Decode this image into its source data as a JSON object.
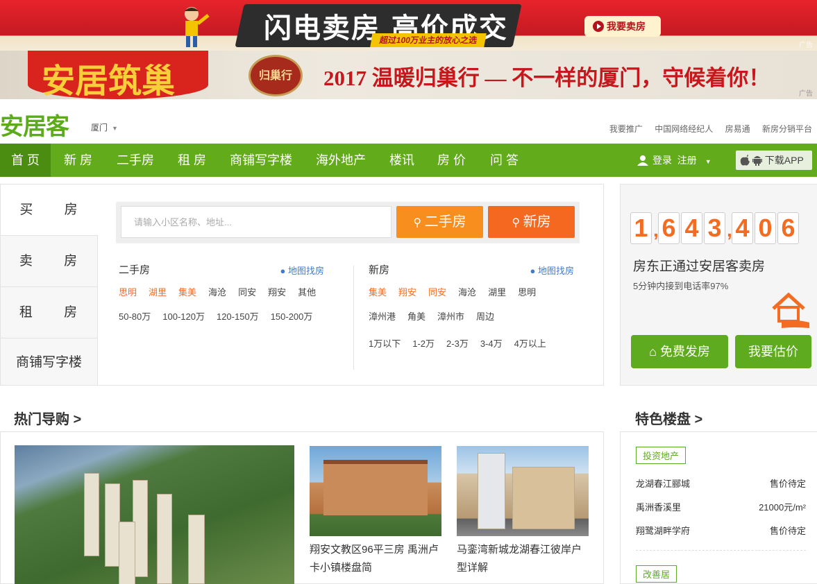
{
  "ad_top": {
    "title": "闪电卖房 高价成交",
    "subtitle": "超过100万业主的放心之选",
    "cta": "我要卖房",
    "ad_label": "广告"
  },
  "ad_second": {
    "left_text": "安居筑巢",
    "seal_text": "归巢行",
    "slogan": "2017 温暖归巢行 — 不一样的厦门，守候着你！",
    "ad_label": "广告"
  },
  "header": {
    "logo": "安居客",
    "city": "厦门",
    "links": [
      "我要推广",
      "中国网络经纪人",
      "房易通",
      "新房分销平台"
    ]
  },
  "nav": {
    "items": [
      "首 页",
      "新 房",
      "二手房",
      "租 房",
      "商铺写字楼",
      "海外地产",
      "楼讯",
      "房 价",
      "问 答"
    ],
    "login": "登录",
    "register": "注册",
    "app": "下载APP"
  },
  "search": {
    "tabs": [
      "买 房",
      "卖 房",
      "租 房",
      "商铺写字楼"
    ],
    "placeholder": "请输入小区名称、地址...",
    "btn_used": "二手房",
    "btn_new": "新房",
    "used": {
      "title": "二手房",
      "map": "地图找房",
      "areas": [
        "思明",
        "湖里",
        "集美",
        "海沧",
        "同安",
        "翔安",
        "其他"
      ],
      "hot_count": 3,
      "prices": [
        "50-80万",
        "100-120万",
        "120-150万",
        "150-200万"
      ]
    },
    "new": {
      "title": "新房",
      "map": "地图找房",
      "areas1": [
        "集美",
        "翔安",
        "同安",
        "海沧",
        "湖里",
        "思明"
      ],
      "hot_count": 3,
      "areas2": [
        "漳州港",
        "角美",
        "漳州市",
        "周边"
      ],
      "prices": [
        "1万以下",
        "1-2万",
        "2-3万",
        "3-4万",
        "4万以上"
      ]
    }
  },
  "side": {
    "digits": [
      "1",
      "6",
      "4",
      "3",
      "4",
      "0",
      "6"
    ],
    "count": "1,643,406",
    "text1": "房东正通过安居客卖房",
    "text2": "5分钟内接到电话率97%",
    "btn_publish": "免费发房",
    "btn_estimate": "我要估价"
  },
  "hot": {
    "title": "热门导购 >",
    "captions": [
      "翔安文教区96平三房 禹洲卢卡小镇楼盘简",
      "马銮湾新城龙湖春江彼岸户型详解"
    ]
  },
  "featured": {
    "title": "特色楼盘 >",
    "badge": "投资地产",
    "rows": [
      {
        "name": "龙湖春江郦城",
        "price": "售价待定"
      },
      {
        "name": "禹洲香溪里",
        "price": "21000元/m²"
      },
      {
        "name": "翔鹭湖畔学府",
        "price": "售价待定"
      }
    ],
    "badge2": "改善居"
  },
  "colors": {
    "green": "#62ab1b",
    "orange": "#f78e1e",
    "orange_dark": "#f5681f",
    "red": "#e8232b"
  }
}
